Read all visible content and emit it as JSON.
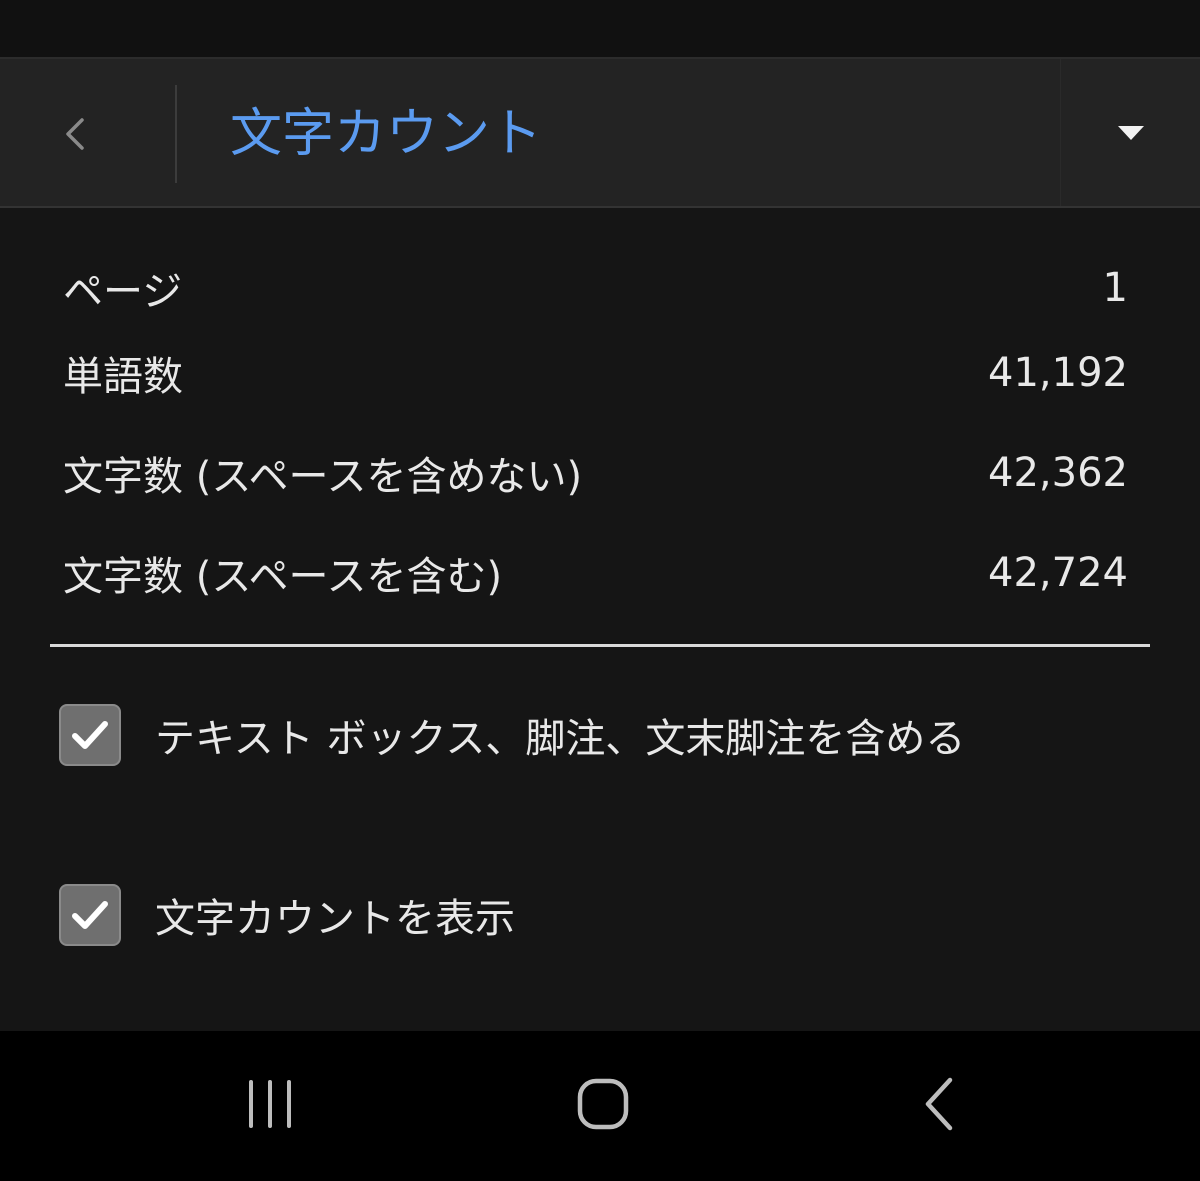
{
  "header": {
    "title": "文字カウント"
  },
  "stats": [
    {
      "label": "ページ",
      "value": "1"
    },
    {
      "label": "単語数",
      "value": "41,192"
    },
    {
      "label": "文字数 (スペースを含めない)",
      "value": "42,362"
    },
    {
      "label": "文字数 (スペースを含む)",
      "value": "42,724"
    }
  ],
  "options": [
    {
      "label": "テキスト ボックス、脚注、文末脚注を含める",
      "checked": true
    },
    {
      "label": "文字カウントを表示",
      "checked": true
    }
  ],
  "colors": {
    "title_accent": "#5b9bf0",
    "background": "#151515",
    "header_background": "#232323",
    "checkbox_fill": "#6f6f6f"
  },
  "icons": {
    "back": "chevron-left-icon",
    "dropdown": "caret-down-icon",
    "nav_recents": "recent-apps-icon",
    "nav_home": "home-icon",
    "nav_back": "back-icon"
  }
}
